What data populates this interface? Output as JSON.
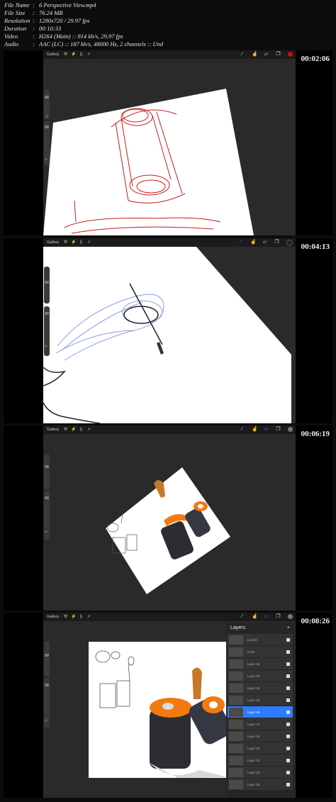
{
  "file_info": [
    {
      "key": "File Name",
      "value": "6 Perspective View.mp4"
    },
    {
      "key": "File Size",
      "value": "76.24 MB"
    },
    {
      "key": "Resolution",
      "value": "1280x720 / 29.97 fps"
    },
    {
      "key": "Duration",
      "value": "00:10:33"
    },
    {
      "key": "Video",
      "value": "H264 (Main) :: 814 kb/s, 29.97 fps"
    },
    {
      "key": "Audio",
      "value": "AAC (LC) :: 187 kb/s, 48000 Hz, 2 channels :: Und"
    }
  ],
  "separator": ":",
  "app": {
    "gallery_label": "Gallery"
  },
  "frames": [
    {
      "timestamp": "00:02:06",
      "color_swatch": "#c81010"
    },
    {
      "timestamp": "00:04:13",
      "color_swatch": "#222222"
    },
    {
      "timestamp": "00:06:19",
      "color_swatch": "#777777"
    },
    {
      "timestamp": "00:08:26",
      "color_swatch": "#777777"
    }
  ],
  "layers_panel": {
    "title": "Layers",
    "add_symbol": "+",
    "items": [
      {
        "name": "Lineart",
        "active": false
      },
      {
        "name": "Color",
        "active": false
      },
      {
        "name": "Layer 34",
        "active": false
      },
      {
        "name": "Layer 30",
        "active": false
      },
      {
        "name": "Layer 29",
        "active": false
      },
      {
        "name": "Layer 28",
        "active": false
      },
      {
        "name": "Layer 35",
        "active": true
      },
      {
        "name": "Layer 27",
        "active": false
      },
      {
        "name": "Layer 16",
        "active": false
      },
      {
        "name": "Layer 24",
        "active": false
      },
      {
        "name": "Layer 22",
        "active": false
      },
      {
        "name": "Layer 23",
        "active": false
      },
      {
        "name": "Layer 33",
        "active": false
      }
    ]
  }
}
